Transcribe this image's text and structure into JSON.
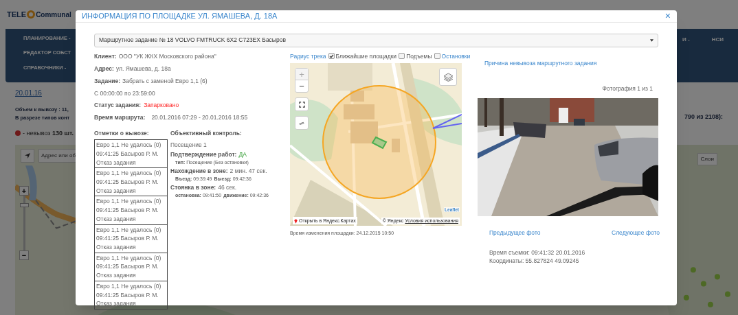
{
  "background": {
    "logo": {
      "prefix": "TELE",
      "brand": "Communal"
    },
    "nav_left": [
      "ПЛАНИРОВАНИЕ -",
      "РЕДАКТОР СОБСТ",
      "СПРАВОЧНИКИ -"
    ],
    "nav_right": [
      "И -",
      "НСИ"
    ],
    "date": "20.01.16",
    "summary_lines": [
      "Объем к вывозу : 11,",
      "В разрезе типов конт"
    ],
    "summary_right": "790 из 2108):",
    "legend": {
      "label": "- невывоз",
      "count": "130 шт."
    },
    "map": {
      "search_placeholder": "Адрес или об",
      "layers": "Слои",
      "zoom_in": "+",
      "zoom_out": "−",
      "zoom": {
        "level": 0.85
      }
    }
  },
  "modal": {
    "title": "ИНФОРМАЦИЯ ПО ПЛОЩАДКЕ УЛ. ЯМАШЕВА, Д. 18А",
    "close": "×",
    "route_select": "Маршрутное задание № 18 VOLVO FMTRUCK 6X2 С723ЕХ Басыров",
    "fields": [
      {
        "kind": "field",
        "label": "Клиент:",
        "value": "ООО \"УК ЖКХ Московского района\""
      },
      {
        "kind": "field",
        "label": "Адрес:",
        "value": "ул. Ямашева, д. 18а"
      },
      {
        "kind": "field",
        "label": "Задание:",
        "value": "Забрать с заменой Евро 1,1 (6)"
      },
      {
        "kind": "plain",
        "value": "С 00:00:00 по 23:59:00"
      },
      {
        "kind": "alert",
        "label": "Статус задания:",
        "value": "Запарковано"
      },
      {
        "kind": "wide",
        "label": "Время маршрута:",
        "value": "20.01.2016 07:29 - 20.01.2016 18:55"
      }
    ],
    "marks_title": "Отметки о вывозе:",
    "marks": [
      {
        "lines": [
          "Евро 1,1 Не удалось (0)",
          "09:41:25 Басыров Р. М.",
          "Отказ задания"
        ]
      },
      {
        "lines": [
          "Евро 1,1 Не удалось (0)",
          "09:41:25 Басыров Р. М.",
          "Отказ задания"
        ]
      },
      {
        "lines": [
          "Евро 1,1 Не удалось (0)",
          "09:41:25 Басыров Р. М.",
          "Отказ задания"
        ]
      },
      {
        "lines": [
          "Евро 1,1 Не удалось (0)",
          "09:41:25 Басыров Р. М.",
          "Отказ задания"
        ]
      },
      {
        "lines": [
          "Евро 1,1 Не удалось (0)",
          "09:41:25 Басыров Р. М.",
          "Отказ задания"
        ]
      },
      {
        "lines": [
          "Евро 1,1 Не удалось (0)",
          "09:41:25 Басыров Р. М.",
          "Отказ задания"
        ]
      }
    ],
    "control_title": "Объективный контроль:",
    "control": [
      {
        "kind": "plain",
        "value": "Посещение 1"
      },
      {
        "kind": "ok",
        "label": "Подтверждение работ:",
        "value": "ДА"
      },
      {
        "kind": "detail",
        "parts": [
          {
            "label": "тип:",
            "value": "Посещение (Без остановки)"
          }
        ]
      },
      {
        "kind": "field",
        "label": "Нахождение в зоне:",
        "value": "2 мин. 47 сек."
      },
      {
        "kind": "detail",
        "parts": [
          {
            "label": "Въезд:",
            "value": "09:39:49"
          },
          {
            "label": "Выезд:",
            "value": "09:42:36"
          }
        ]
      },
      {
        "kind": "field",
        "label": "Стоянка в зоне:",
        "value": "46 сек."
      },
      {
        "kind": "detail",
        "parts": [
          {
            "label": "остановка:",
            "value": "09:41:50"
          },
          {
            "label": "движение:",
            "value": "09:42:36"
          }
        ]
      }
    ],
    "map_options": [
      {
        "kind": "link",
        "label": "Радиус трека"
      },
      {
        "kind": "checkbox",
        "checked": true,
        "label": "Ближайшие площадки"
      },
      {
        "kind": "checkbox",
        "checked": false,
        "label": "Подъемы"
      },
      {
        "kind": "checkbox-link",
        "checked": false,
        "label": "Остановки"
      }
    ],
    "map": {
      "zoom_in": {
        "label": "+",
        "disabled": true
      },
      "zoom_out": {
        "label": "−",
        "disabled": false
      },
      "open_link": "Открыть в Яндекс.Картах",
      "leaflet": "Leaflet",
      "copyright": "© Яндекс",
      "terms": "Условия использования"
    },
    "map_caption": "Время изменения площадки: 24.12.2015 10:50",
    "reason_link": "Причина невывоза маршрутного задания",
    "photo_counter": "Фотография 1 из 1",
    "prev_photo": "Предыдущее фото",
    "next_photo": "Следующее фото",
    "photo_info": [
      "Время съемки: 09:41:32 20.01.2016",
      "Координаты: 55.827824 49.09245"
    ]
  }
}
